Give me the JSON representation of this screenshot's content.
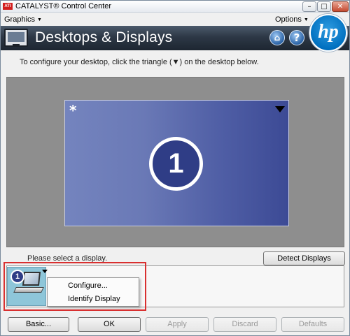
{
  "window": {
    "title": "CATALYST® Control Center",
    "logo_text": "ATI",
    "controls": {
      "minimize": "–",
      "maximize": "□",
      "close": "✕"
    }
  },
  "menubar": {
    "graphics": "Graphics",
    "options": "Options",
    "caret": "▼"
  },
  "header": {
    "title": "Desktops & Displays",
    "home_icon": "⌂",
    "help_icon": "?",
    "brand": "hp"
  },
  "main": {
    "instruction": "To configure your desktop, click the triangle (▼) on the desktop below.",
    "desktop": {
      "star": "*",
      "number": "1"
    },
    "select_label": "Please select a display.",
    "detect_button": "Detect Displays"
  },
  "display_panel": {
    "thumbnail_number": "1",
    "context_menu": [
      "Configure...",
      "Identify Display"
    ]
  },
  "footer": {
    "basic": "Basic...",
    "ok": "OK",
    "apply": "Apply",
    "discard": "Discard",
    "defaults": "Defaults"
  },
  "colors": {
    "header_bg": "#2d3846",
    "desktop_bg": "#5a69ae",
    "highlight": "#d93030",
    "brand_blue": "#0070c0"
  }
}
